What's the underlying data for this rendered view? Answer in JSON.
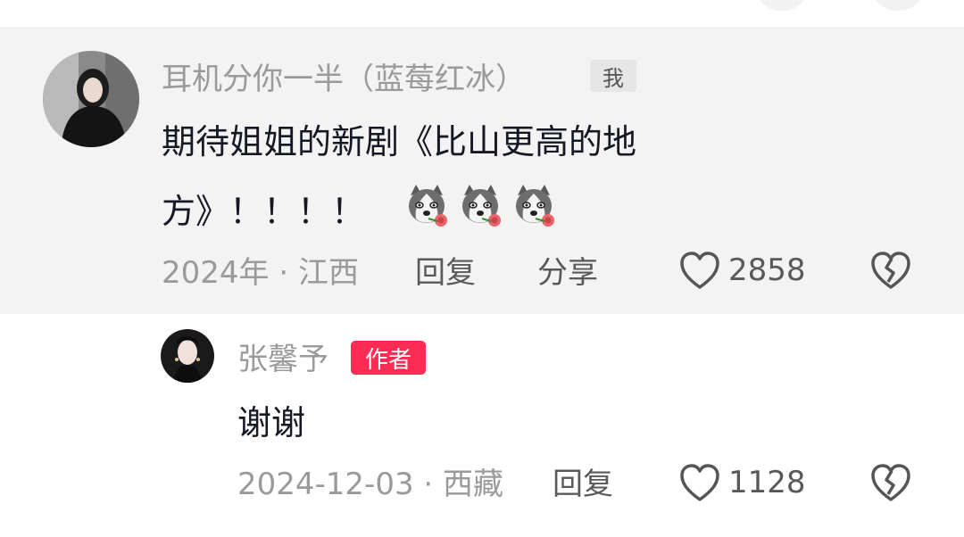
{
  "comment": {
    "username": "耳机分你一半（蓝莓红冰）",
    "me_tag": "我",
    "text_line1": "期待姐姐的新剧《比山更高的地",
    "text_line2": "方》！！！！",
    "emoji": [
      "husky-rose-emoji",
      "husky-rose-emoji",
      "husky-rose-emoji"
    ],
    "meta": "2024年 · 江西",
    "reply_label": "回复",
    "share_label": "分享",
    "like_count": "2858"
  },
  "reply": {
    "username": "张馨予",
    "author_tag": "作者",
    "text": "谢谢",
    "meta": "2024-12-03 · 西藏",
    "reply_label": "回复",
    "like_count": "1128"
  },
  "colors": {
    "author_tag_bg": "#fe2c55",
    "comment_bg": "#f3f3f3",
    "muted_text": "#9a9a9a"
  }
}
